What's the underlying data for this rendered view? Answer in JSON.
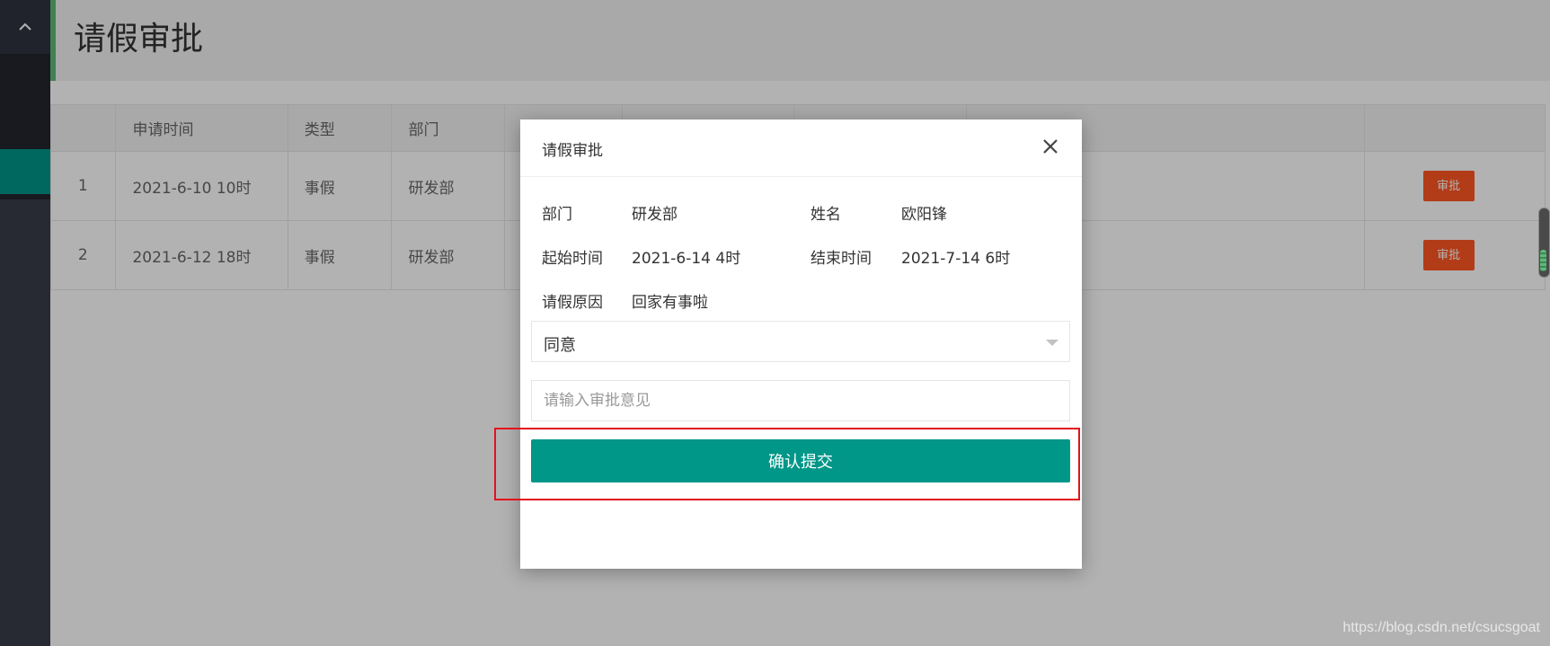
{
  "sidebar": {
    "toggle_icon": "chevron-up-icon"
  },
  "page": {
    "title": "请假审批"
  },
  "table": {
    "columns": [
      "",
      "申请时间",
      "类型",
      "部门",
      "",
      "",
      "",
      "",
      "",
      ""
    ],
    "rows": [
      {
        "index": "1",
        "apply_time": "2021-6-10 10时",
        "type": "事假",
        "dept": "研发部",
        "action": "审批"
      },
      {
        "index": "2",
        "apply_time": "2021-6-12 18时",
        "type": "事假",
        "dept": "研发部",
        "action": "审批"
      }
    ]
  },
  "modal": {
    "title": "请假审批",
    "close_icon": "close-icon",
    "dept_label": "部门",
    "dept_value": "研发部",
    "name_label": "姓名",
    "name_value": "欧阳锋",
    "start_label": "起始时间",
    "start_value": "2021-6-14 4时",
    "end_label": "结束时间",
    "end_value": "2021-7-14 6时",
    "reason_label": "请假原因",
    "reason_value": "回家有事啦",
    "decision_selected": "同意",
    "comment_placeholder": "请输入审批意见",
    "comment_value": "",
    "submit_label": "确认提交"
  },
  "watermark": "https://blog.csdn.net/csucsgoat",
  "colors": {
    "accent": "#009688",
    "danger": "#ff5722",
    "highlight": "#e3121c"
  }
}
